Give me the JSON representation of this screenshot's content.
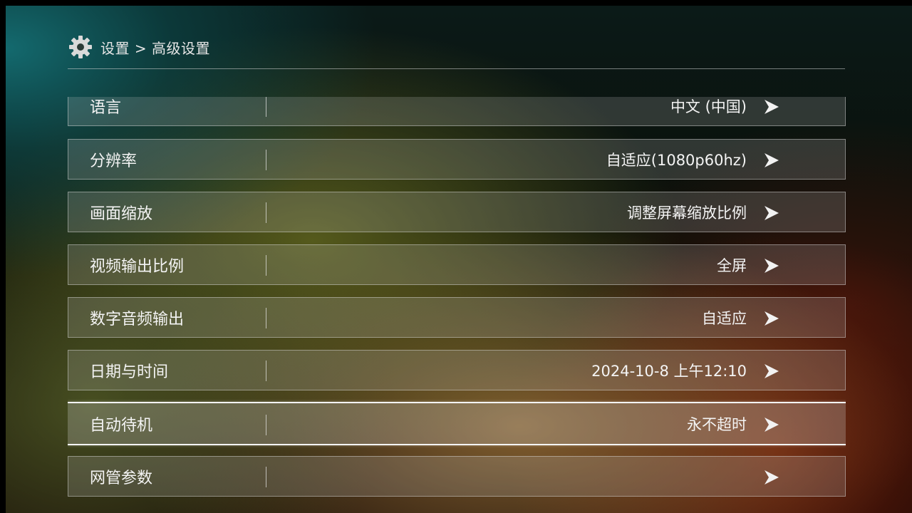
{
  "header": {
    "icon": "gear-icon",
    "breadcrumb": "设置 > 高级设置"
  },
  "rows": [
    {
      "label": "语言",
      "value": "中文 (中国)"
    },
    {
      "label": "分辨率",
      "value": "自适应(1080p60hz)"
    },
    {
      "label": "画面缩放",
      "value": "调整屏幕缩放比例"
    },
    {
      "label": "视频输出比例",
      "value": "全屏"
    },
    {
      "label": "数字音频输出",
      "value": "自适应"
    },
    {
      "label": "日期与时间",
      "value": "2024-10-8 上午12:10"
    },
    {
      "label": "自动待机",
      "value": "永不超时",
      "focused": true
    },
    {
      "label": "网管参数",
      "value": ""
    }
  ],
  "arrow_icon": "chevron-right-icon"
}
